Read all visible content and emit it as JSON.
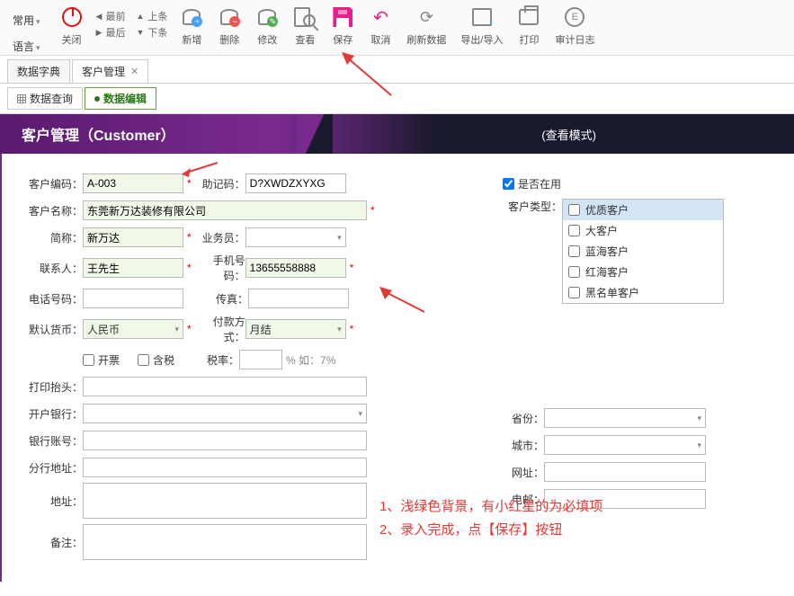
{
  "menus": {
    "common": "常用",
    "language": "语言"
  },
  "toolbar": {
    "close": "关闭",
    "first": "最前",
    "prev": "上条",
    "last": "最后",
    "next": "下条",
    "add": "新增",
    "delete": "删除",
    "edit": "修改",
    "view": "查看",
    "save": "保存",
    "cancel": "取消",
    "refresh": "刷新数据",
    "export": "导出/导入",
    "print": "打印",
    "audit": "审计日志"
  },
  "tabs": {
    "dict": "数据字典",
    "customer": "客户管理"
  },
  "subtabs": {
    "query": "数据查询",
    "edit": "数据编辑"
  },
  "header": {
    "title": "客户管理（Customer）",
    "mode": "(查看模式)"
  },
  "labels": {
    "code": "客户编码：",
    "mnemonic": "助记码：",
    "name": "客户名称：",
    "short": "简称：",
    "salesman": "业务员：",
    "contact": "联系人：",
    "mobile": "手机号码：",
    "phone": "电话号码：",
    "fax": "传真：",
    "currency": "默认货币：",
    "payment": "付款方式：",
    "invoice": "开票",
    "tax_incl": "含税",
    "tax_rate": "税率：",
    "tax_hint": "% 如：7%",
    "print_title": "打印抬头：",
    "bank": "开户银行：",
    "account": "银行账号：",
    "branch_addr": "分行地址：",
    "address": "地址：",
    "remark": "备注：",
    "in_use": "是否在用",
    "cust_type": "客户类型：",
    "province": "省份：",
    "city": "城市：",
    "website": "网址：",
    "email": "电邮："
  },
  "values": {
    "code": "A-003",
    "mnemonic": "D?XWDZXYXG",
    "name": "东莞新万达装修有限公司",
    "short": "新万达",
    "contact": "王先生",
    "mobile": "13655558888",
    "currency": "人民币",
    "payment": "月结",
    "in_use_checked": true
  },
  "cust_types": [
    "优质客户",
    "大客户",
    "蓝海客户",
    "红海客户",
    "黑名单客户"
  ],
  "notes": {
    "line1": "1、浅绿色背景，有小红星的为必填项",
    "line2": "2、录入完成，点【保存】按钮"
  }
}
